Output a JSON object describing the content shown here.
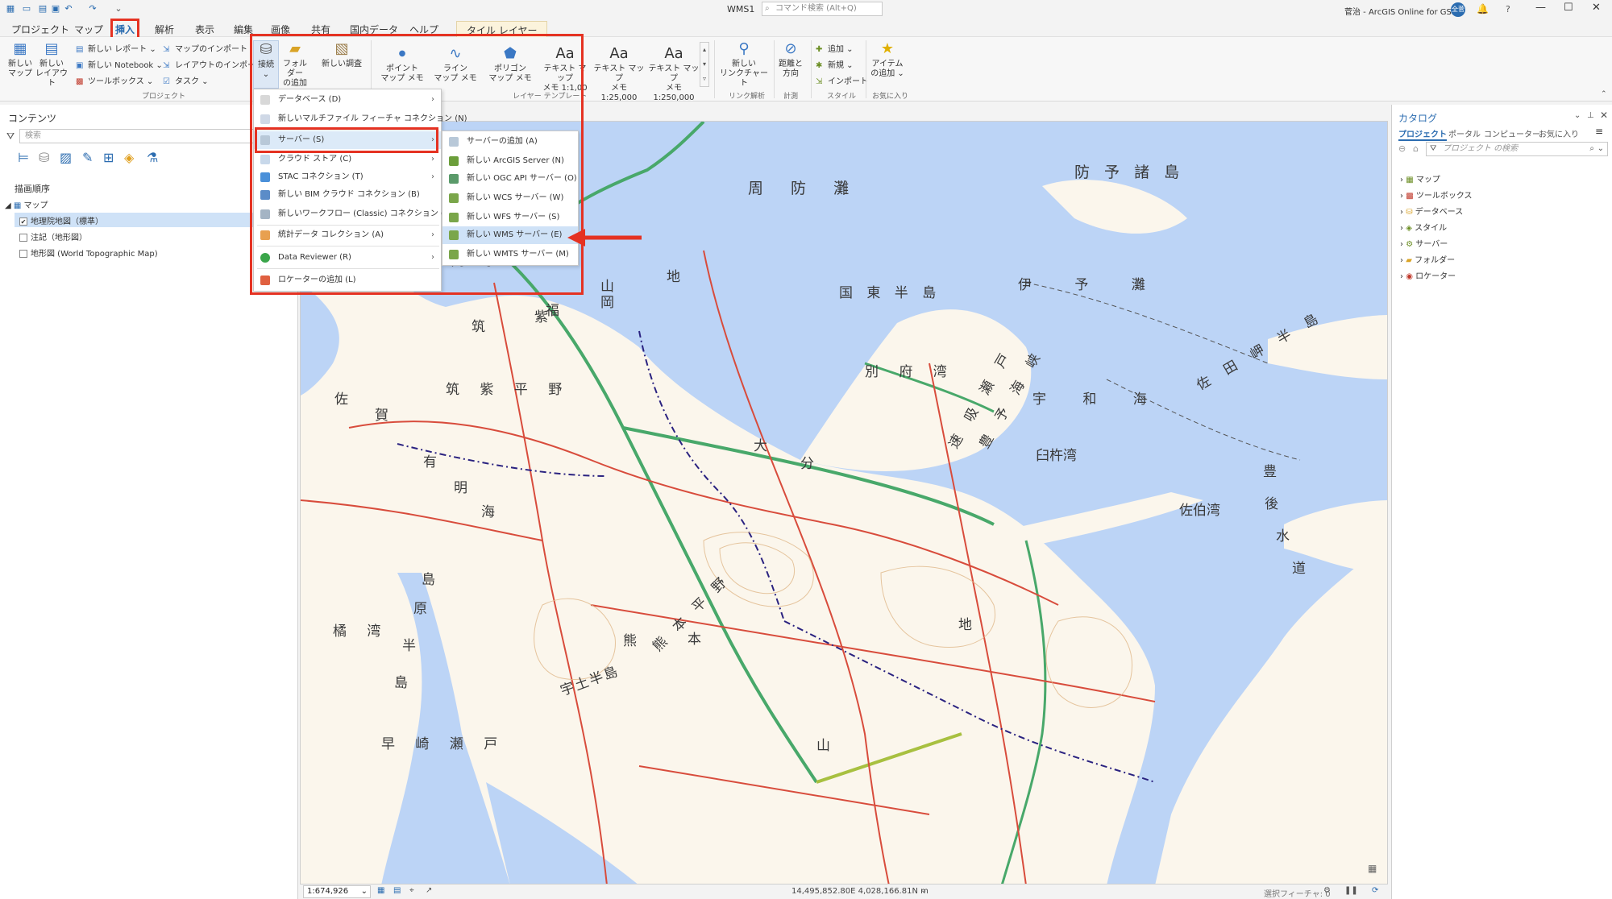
{
  "window": {
    "title": "WMS1",
    "command_search_placeholder": "コマンド検索 (Alt+Q)",
    "user": "菅治 - ArcGIS Online for GSI",
    "user_initials": "全菅",
    "help": "?"
  },
  "tabs": [
    "プロジェクト",
    "マップ",
    "挿入",
    "解析",
    "表示",
    "編集",
    "画像",
    "共有",
    "国内データ",
    "ヘルプ",
    "タイル レイヤー"
  ],
  "active_tab": "挿入",
  "ribbon": {
    "project_group": {
      "label": "プロジェクト",
      "new_map": "新しい\nマップ",
      "new_layout": "新しい\nレイアウト",
      "new_report": "新しい レポート",
      "new_notebook": "新しい Notebook",
      "toolbox": "ツールボックス",
      "import_map": "マップのインポート",
      "import_layout": "レイアウトのインポート",
      "task": "タスク"
    },
    "connect": "接続",
    "add_folder": "フォルダー\nの追加",
    "new_survey": "新しい調査",
    "layer_template_group": {
      "label": "レイヤー テンプレート",
      "point_memo": "ポイント\nマップ メモ",
      "line_memo": "ライン\nマップ メモ",
      "polygon_memo": "ポリゴン\nマップ メモ",
      "text_memo_1": "テキスト マップ\nメモ 1:1,00",
      "text_memo_2": "テキスト マップ\nメモ 1:25,000",
      "text_memo_3": "テキスト マップ\nメモ 1:250,000"
    },
    "link_group": {
      "label": "リンク解析",
      "new_link_chart": "新しい\nリンクチャート"
    },
    "measure_group": {
      "label": "計測",
      "distance_direction": "距離と\n方向"
    },
    "style_group": {
      "label": "スタイル",
      "add": "追加",
      "new": "新規",
      "import": "インポート"
    },
    "favorites_group": {
      "label": "お気に入り",
      "add_item": "アイテム\nの追加"
    }
  },
  "connect_menu": {
    "items": [
      {
        "label": "データベース (D)",
        "submenu": true
      },
      {
        "label": "新しいマルチファイル フィーチャ コネクション (N)",
        "submenu": false
      },
      {
        "label": "サーバー (S)",
        "submenu": true
      },
      {
        "label": "クラウド ストア (C)",
        "submenu": true
      },
      {
        "label": "STAC コネクション (T)",
        "submenu": true
      },
      {
        "label": "新しい BIM クラウド コネクション (B)",
        "submenu": false
      },
      {
        "label": "新しいワークフロー (Classic) コネクション (W)",
        "submenu": false
      },
      {
        "label": "統計データ コレクション (A)",
        "submenu": true
      },
      {
        "label": "Data Reviewer (R)",
        "submenu": true
      },
      {
        "label": "ロケーターの追加 (L)",
        "submenu": false
      }
    ]
  },
  "server_submenu": {
    "items": [
      "サーバーの追加 (A)",
      "新しい ArcGIS Server (N)",
      "新しい OGC API サーバー (O)",
      "新しい WCS サーバー (W)",
      "新しい WFS サーバー (S)",
      "新しい WMS サーバー (E)",
      "新しい WMTS サーバー (M)"
    ],
    "highlighted": "新しい WMS サーバー (E)"
  },
  "contents_pane": {
    "title": "コンテンツ",
    "search_placeholder": "検索",
    "drawing_order": "描画順序",
    "map": "マップ",
    "layers": [
      {
        "name": "地理院地図（標準）",
        "checked": true
      },
      {
        "name": "注記（地形図）",
        "checked": false
      },
      {
        "name": "地形図 (World Topographic Map)",
        "checked": false
      }
    ]
  },
  "catalog_pane": {
    "title": "カタログ",
    "tabs": [
      "プロジェクト",
      "ポータル",
      "コンピューター",
      "お気に入り"
    ],
    "search_placeholder": "プロジェクト の検索",
    "items": [
      "マップ",
      "ツールボックス",
      "データベース",
      "スタイル",
      "サーバー",
      "フォルダー",
      "ロケーター"
    ]
  },
  "map_labels": [
    "周 防 灘",
    "防 予 諸 島",
    "国 東 半 島",
    "伊 予 灘",
    "福 岡 湾",
    "福",
    "岡",
    "山",
    "筑",
    "紫",
    "地",
    "別 府 湾",
    "佐 田 岬 半 島",
    "速 吸 瀬 戸",
    "豊 予 海 峡",
    "宇 和 海",
    "臼杵湾",
    "大",
    "分",
    "佐",
    "賀",
    "筑 紫 平 野",
    "有",
    "明",
    "海",
    "佐伯湾",
    "豊",
    "後",
    "水",
    "道",
    "島",
    "原",
    "半",
    "島",
    "橘 湾",
    "熊 本 平 野",
    "熊",
    "本",
    "宇土半島",
    "早 崎 瀬 戸",
    "地",
    "山"
  ],
  "status": {
    "scale": "1:674,926",
    "coordinates": "14,495,852.80E 4,028,166.81N m",
    "selected_features": "選択フィーチャ: 0"
  },
  "colors": {
    "highlight_red": "#e53222",
    "water": "#bcd4f6",
    "land": "#fbf6ec",
    "accent": "#2b6cb0"
  }
}
